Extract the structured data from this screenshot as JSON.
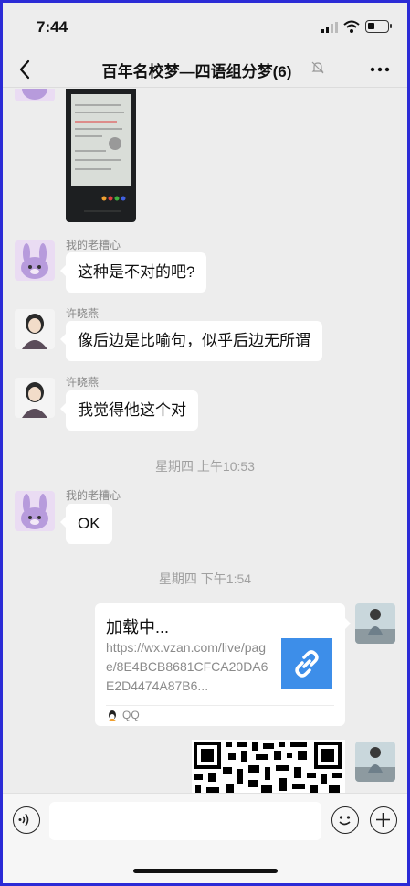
{
  "status_bar": {
    "time": "7:44"
  },
  "nav": {
    "title": "百年名校梦—四语组分梦(6)"
  },
  "messages": [
    {
      "sender": "我的老糟心",
      "text": "这种是不对的吧?"
    },
    {
      "sender": "许晓燕",
      "text": "像后边是比喻句，似乎后边无所谓"
    },
    {
      "sender": "许晓燕",
      "text": "我觉得他这个对"
    },
    {
      "sender": "我的老糟心",
      "text": "OK"
    }
  ],
  "timestamps": [
    "星期四 上午10:53",
    "星期四 下午1:54"
  ],
  "link_card": {
    "title": "加载中...",
    "url": "https://wx.vzan.com/live/page/8E4BCB8681CFCA20DA6E2D4474A87B6...",
    "source": "QQ"
  },
  "icons": {
    "back": "chevron-left-icon",
    "mute": "bell-slash-icon",
    "more": "more-dots-icon",
    "voice": "voice-icon",
    "emoji": "emoji-icon",
    "plus": "plus-icon",
    "link": "link-icon",
    "qq": "qq-penguin-icon"
  },
  "colors": {
    "background": "#ededed",
    "bubble": "#ffffff",
    "link_thumb": "#3d8ee9"
  }
}
